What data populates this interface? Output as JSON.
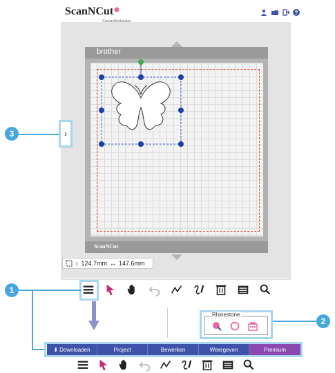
{
  "header": {
    "logo": "ScanNCut",
    "logo_sub": "CanvasWorkspace",
    "icons": [
      "user-icon",
      "folder-icon",
      "logout-icon",
      "help-icon"
    ]
  },
  "mat": {
    "brand": "brother",
    "bottom_logo": "ScanNCut"
  },
  "size_readout": {
    "height": "124.7mm",
    "width": "147.6mm"
  },
  "side_tab": {
    "label": "›"
  },
  "callouts": {
    "one": "1",
    "two": "2",
    "three": "3"
  },
  "toolbar": {
    "tools": [
      "menu-icon",
      "select-arrow-icon",
      "hand-icon",
      "undo-icon",
      "line-draw-icon",
      "curve-draw-icon",
      "trash-icon",
      "list-icon",
      "search-icon"
    ]
  },
  "rhinestone": {
    "label": "Rhinestone",
    "icons": [
      "rhinestone-add-icon",
      "rhinestone-circle-icon",
      "rhinestone-fill-icon"
    ]
  },
  "menu_bar": {
    "items": [
      "Downloaden",
      "Project",
      "Bewerken",
      "Weergeven",
      "Premium"
    ]
  },
  "colors": {
    "accent_blue": "#3d52a8",
    "premium_purple": "#8a48b0",
    "callout": "#48a7df",
    "highlight": "#a9d5f0",
    "handle": "#1f3ea6",
    "cut_line": "#e0523e"
  }
}
